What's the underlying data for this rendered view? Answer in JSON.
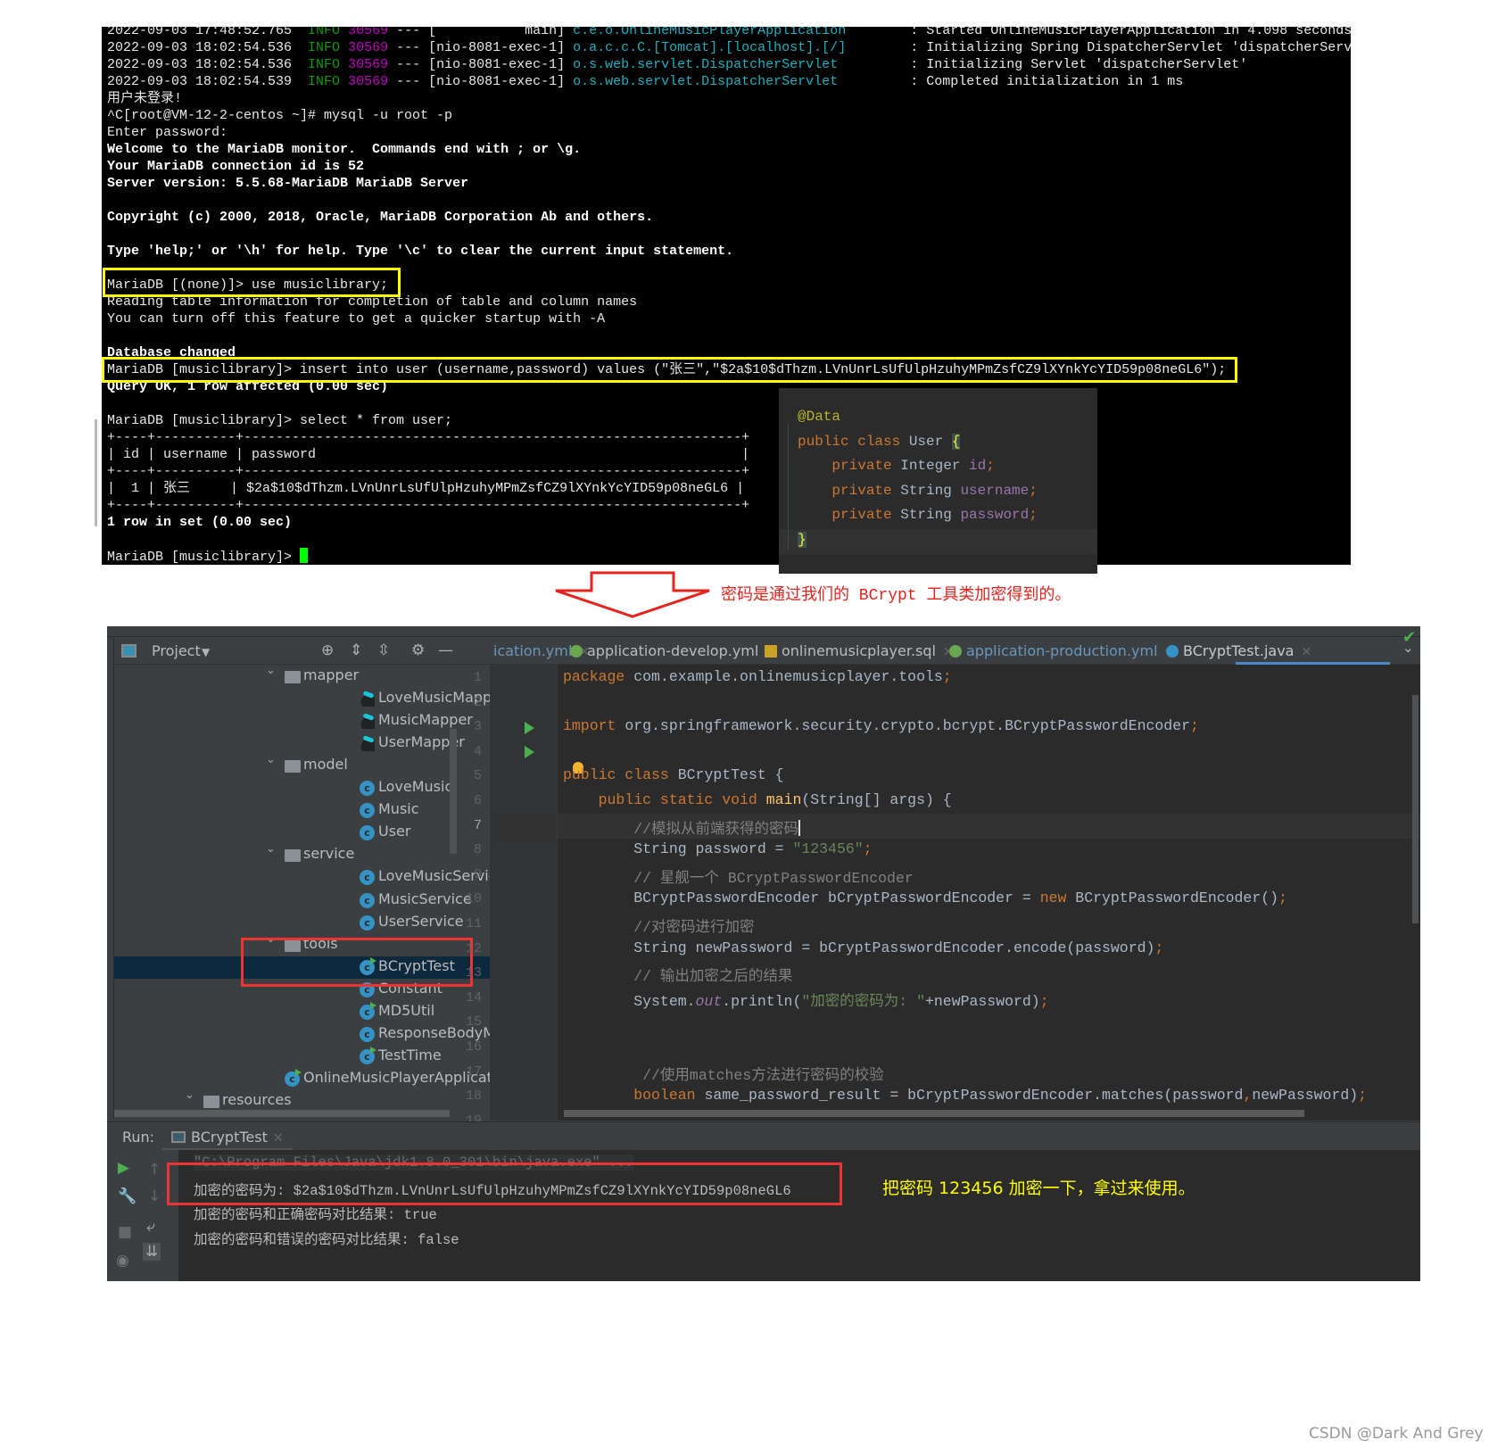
{
  "terminal": {
    "lines": [
      [
        {
          "t": "2022-09-03 17:48:52.765  ",
          "c": "w"
        },
        {
          "t": "INFO",
          "c": "g"
        },
        {
          "t": " ",
          "c": "w"
        },
        {
          "t": "30569",
          "c": "m"
        },
        {
          "t": " --- [           main] ",
          "c": "w"
        },
        {
          "t": "c.e.o.OnlineMusicPlayerApplication        ",
          "c": "c"
        },
        {
          "t": ": Started OnlineMusicPlayerApplication in 4.098 seconds",
          "c": "w"
        }
      ],
      [
        {
          "t": "2022-09-03 18:02:54.536  ",
          "c": "w"
        },
        {
          "t": "INFO",
          "c": "g"
        },
        {
          "t": " ",
          "c": "w"
        },
        {
          "t": "30569",
          "c": "m"
        },
        {
          "t": " --- [nio-8081-exec-1] ",
          "c": "w"
        },
        {
          "t": "o.a.c.c.C.[Tomcat].[localhost].[/]        ",
          "c": "c"
        },
        {
          "t": ": Initializing Spring DispatcherServlet 'dispatcherServl",
          "c": "w"
        }
      ],
      [
        {
          "t": "2022-09-03 18:02:54.536  ",
          "c": "w"
        },
        {
          "t": "INFO",
          "c": "g"
        },
        {
          "t": " ",
          "c": "w"
        },
        {
          "t": "30569",
          "c": "m"
        },
        {
          "t": " --- [nio-8081-exec-1] ",
          "c": "w"
        },
        {
          "t": "o.s.web.servlet.DispatcherServlet         ",
          "c": "c"
        },
        {
          "t": ": Initializing Servlet 'dispatcherServlet'",
          "c": "w"
        }
      ],
      [
        {
          "t": "2022-09-03 18:02:54.539  ",
          "c": "w"
        },
        {
          "t": "INFO",
          "c": "g"
        },
        {
          "t": " ",
          "c": "w"
        },
        {
          "t": "30569",
          "c": "m"
        },
        {
          "t": " --- [nio-8081-exec-1] ",
          "c": "w"
        },
        {
          "t": "o.s.web.servlet.DispatcherServlet         ",
          "c": "c"
        },
        {
          "t": ": Completed initialization in 1 ms",
          "c": "w"
        }
      ],
      [
        {
          "t": "用户未登录!",
          "c": "w"
        }
      ],
      [
        {
          "t": "^C[root@VM-12-2-centos ~]# mysql -u root -p",
          "c": "w"
        }
      ],
      [
        {
          "t": "Enter password:",
          "c": "w"
        }
      ],
      [
        {
          "t": "Welcome to the MariaDB monitor.  Commands end with ; or \\g.",
          "c": "b"
        }
      ],
      [
        {
          "t": "Your MariaDB connection id is 52",
          "c": "b"
        }
      ],
      [
        {
          "t": "Server version: 5.5.68-MariaDB MariaDB Server",
          "c": "b"
        }
      ],
      [],
      [
        {
          "t": "Copyright (c) 2000, 2018, Oracle, MariaDB Corporation Ab and others.",
          "c": "b"
        }
      ],
      [],
      [
        {
          "t": "Type 'help;' or '\\h' for help. Type '\\c' to clear the current input statement.",
          "c": "b"
        }
      ],
      [],
      [
        {
          "t": "MariaDB [(none)]> use musiclibrary;",
          "c": "w"
        }
      ],
      [
        {
          "t": "Reading table information for completion of table and column names",
          "c": "w"
        }
      ],
      [
        {
          "t": "You can turn off this feature to get a quicker startup with -A",
          "c": "w"
        }
      ],
      [],
      [
        {
          "t": "Database changed",
          "c": "b"
        }
      ],
      [
        {
          "t": "MariaDB [musiclibrary]> insert into user (username,password) values (\"张三\",\"$2a$10$dThzm.LVnUnrLsUfUlpHzuhyMPmZsfCZ9lXYnkYcYID59p08neGL6\");",
          "c": "w"
        }
      ],
      [
        {
          "t": "Query OK, 1 row affected (0.00 sec)",
          "c": "b"
        }
      ],
      [],
      [
        {
          "t": "MariaDB [musiclibrary]> select * from user;",
          "c": "w"
        }
      ],
      [
        {
          "t": "+----+----------+--------------------------------------------------------------+",
          "c": "w"
        }
      ],
      [
        {
          "t": "| id | username | password                                                     |",
          "c": "w"
        }
      ],
      [
        {
          "t": "+----+----------+--------------------------------------------------------------+",
          "c": "w"
        }
      ],
      [
        {
          "t": "|  1 | 张三     | $2a$10$dThzm.LVnUnrLsUfUlpHzuhyMPmZsfCZ9lXYnkYcYID59p08neGL6 |",
          "c": "w"
        }
      ],
      [
        {
          "t": "+----+----------+--------------------------------------------------------------+",
          "c": "w"
        }
      ],
      [
        {
          "t": "1 row in set (0.00 sec)",
          "c": "b"
        }
      ],
      [],
      [
        {
          "t": "MariaDB [musiclibrary]> ",
          "c": "w"
        }
      ]
    ],
    "cursor_color": "#00ff00"
  },
  "user_class": {
    "lines": [
      [
        {
          "t": "@Data",
          "c": "ann"
        }
      ],
      [
        {
          "t": "public class ",
          "c": "kw"
        },
        {
          "t": "User ",
          "c": "txt"
        },
        {
          "t": "{",
          "c": "brace"
        }
      ],
      [
        {
          "t": "    private ",
          "c": "kw"
        },
        {
          "t": "Integer ",
          "c": "txt"
        },
        {
          "t": "id",
          "c": "fld"
        },
        {
          "t": ";",
          "c": "kw"
        }
      ],
      [
        {
          "t": "    private ",
          "c": "kw"
        },
        {
          "t": "String ",
          "c": "txt"
        },
        {
          "t": "username",
          "c": "fld"
        },
        {
          "t": ";",
          "c": "kw"
        }
      ],
      [
        {
          "t": "    private ",
          "c": "kw"
        },
        {
          "t": "String ",
          "c": "txt"
        },
        {
          "t": "password",
          "c": "fld"
        },
        {
          "t": ";",
          "c": "kw"
        }
      ],
      [
        {
          "t": "}",
          "c": "brace"
        }
      ]
    ]
  },
  "annotations": {
    "top_note": "密码是通过我们的 BCrypt 工具类加密得到的。",
    "run_note": "把密码 123456 加密一下，拿过来使用。",
    "watermark": "CSDN @Dark And Grey",
    "highlight_yellow": "#ffff00",
    "highlight_red": "#ee3333"
  },
  "ide": {
    "project_panel": {
      "title": "Project",
      "tree": [
        {
          "label": "mapper",
          "icon": "folder",
          "level": 1,
          "expanded": true
        },
        {
          "label": "LoveMusicMapper",
          "icon": "mapper",
          "level": 2
        },
        {
          "label": "MusicMapper",
          "icon": "mapper",
          "level": 2
        },
        {
          "label": "UserMapper",
          "icon": "mapper",
          "level": 2
        },
        {
          "label": "model",
          "icon": "folder",
          "level": 1,
          "expanded": true
        },
        {
          "label": "LoveMusic",
          "icon": "class",
          "level": 2
        },
        {
          "label": "Music",
          "icon": "class",
          "level": 2
        },
        {
          "label": "User",
          "icon": "class",
          "level": 2
        },
        {
          "label": "service",
          "icon": "folder",
          "level": 1,
          "expanded": true
        },
        {
          "label": "LoveMusicService",
          "icon": "class",
          "level": 2
        },
        {
          "label": "MusicService",
          "icon": "class",
          "level": 2
        },
        {
          "label": "UserService",
          "icon": "class",
          "level": 2
        },
        {
          "label": "tools",
          "icon": "folder",
          "level": 1,
          "expanded": true
        },
        {
          "label": "BCryptTest",
          "icon": "class-run",
          "level": 2,
          "selected": true
        },
        {
          "label": "Constant",
          "icon": "class",
          "level": 2
        },
        {
          "label": "MD5Util",
          "icon": "class-run",
          "level": 2
        },
        {
          "label": "ResponseBodyMessage",
          "icon": "class",
          "level": 2
        },
        {
          "label": "TestTime",
          "icon": "class-run",
          "level": 2
        },
        {
          "label": "OnlineMusicPlayerApplicatio",
          "icon": "spring-app",
          "level": 1
        },
        {
          "label": "resources",
          "icon": "resources-folder",
          "level": 0,
          "expanded": true
        }
      ]
    },
    "tabs": [
      {
        "label": "ication.yml",
        "icon": "",
        "kind": "yml"
      },
      {
        "label": "application-develop.yml",
        "icon": "spring-config-icon",
        "kind": "plain"
      },
      {
        "label": "onlinemusicplayer.sql",
        "icon": "sql-file-icon",
        "kind": "plain"
      },
      {
        "label": "application-production.yml",
        "icon": "spring-config-icon",
        "kind": "yml"
      },
      {
        "label": "BCryptTest.java",
        "icon": "java-class-icon",
        "kind": "plain",
        "active": true
      }
    ],
    "editor": {
      "current_line": 7,
      "lines": [
        [
          {
            "t": "package ",
            "c": "kw"
          },
          {
            "t": "com.example.onlinemusicplayer.tools",
            "c": "txt"
          },
          {
            "t": ";",
            "c": "kw"
          }
        ],
        [],
        [
          {
            "t": "import ",
            "c": "kw"
          },
          {
            "t": "org.springframework.security.crypto.bcrypt.BCryptPasswordEncoder",
            "c": "txt"
          },
          {
            "t": ";",
            "c": "kw"
          }
        ],
        [],
        [
          {
            "t": "public class ",
            "c": "kw"
          },
          {
            "t": "BCryptTest {",
            "c": "txt"
          }
        ],
        [
          {
            "t": "    public static void ",
            "c": "kw"
          },
          {
            "t": "main",
            "c": "fn"
          },
          {
            "t": "(String[] args) {",
            "c": "txt"
          }
        ],
        [
          {
            "t": "        //模拟从前端获得的密码",
            "c": "cm"
          }
        ],
        [
          {
            "t": "        String password = ",
            "c": "txt"
          },
          {
            "t": "\"123456\"",
            "c": "str"
          },
          {
            "t": ";",
            "c": "kw"
          }
        ],
        [
          {
            "t": "        // 星舰一个 BCryptPasswordEncoder",
            "c": "cm"
          }
        ],
        [
          {
            "t": "        BCryptPasswordEncoder bCryptPasswordEncoder = ",
            "c": "txt"
          },
          {
            "t": "new ",
            "c": "kw"
          },
          {
            "t": "BCryptPasswordEncoder()",
            "c": "txt"
          },
          {
            "t": ";",
            "c": "kw"
          }
        ],
        [
          {
            "t": "        //对密码进行加密",
            "c": "cm"
          }
        ],
        [
          {
            "t": "        String newPassword = bCryptPasswordEncoder.encode(password)",
            "c": "txt"
          },
          {
            "t": ";",
            "c": "kw"
          }
        ],
        [
          {
            "t": "        // 输出加密之后的结果",
            "c": "cm"
          }
        ],
        [
          {
            "t": "        System.",
            "c": "txt"
          },
          {
            "t": "out",
            "c": "out"
          },
          {
            "t": ".println(",
            "c": "txt"
          },
          {
            "t": "\"加密的密码为: \"",
            "c": "str"
          },
          {
            "t": "+newPassword)",
            "c": "txt"
          },
          {
            "t": ";",
            "c": "kw"
          }
        ],
        [],
        [],
        [
          {
            "t": "         //使用matches方法进行密码的校验",
            "c": "cm"
          }
        ],
        [
          {
            "t": "        boolean ",
            "c": "kw"
          },
          {
            "t": "same_password_result = bCryptPasswordEncoder.matches(password",
            "c": "txt"
          },
          {
            "t": ",",
            "c": "kw"
          },
          {
            "t": "newPassword)",
            "c": "txt"
          },
          {
            "t": ";",
            "c": "kw"
          }
        ]
      ]
    },
    "run": {
      "label": "Run:",
      "tab": "BCryptTest",
      "output": [
        {
          "text": "\"C:\\Program Files\\Java\\jdk1.8.0_301\\bin\\java.exe\" ...",
          "dim": true
        },
        {
          "text": "加密的密码为: $2a$10$dThzm.LVnUnrLsUfUlpHzuhyMPmZsfCZ9lXYnkYcYID59p08neGL6"
        },
        {
          "text": "加密的密码和正确密码对比结果: true"
        },
        {
          "text": "加密的密码和错误的密码对比结果: false"
        }
      ]
    }
  }
}
